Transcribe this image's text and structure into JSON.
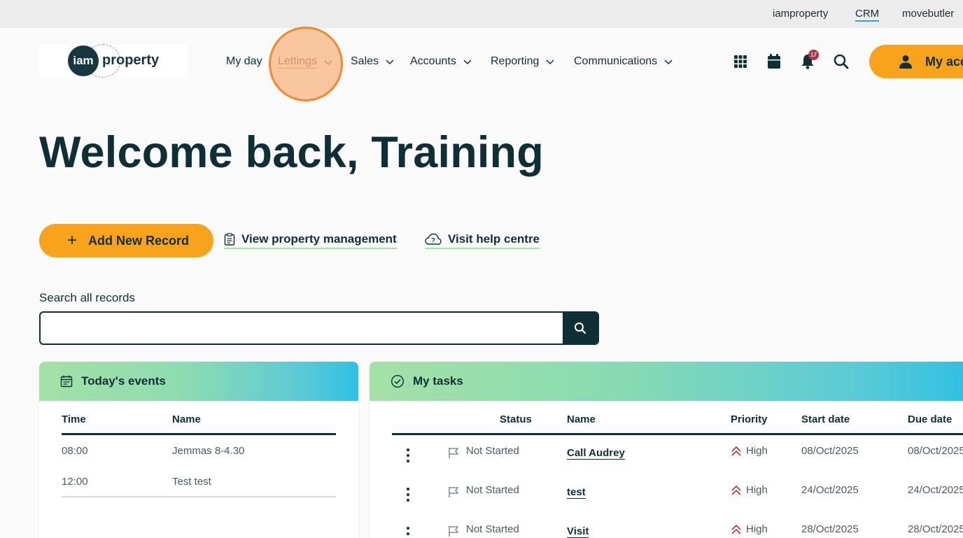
{
  "utility_bar": {
    "links": [
      "iamproperty",
      "CRM",
      "movebutler"
    ],
    "active": "CRM"
  },
  "logo": {
    "mark": "iam",
    "word": "property"
  },
  "nav": {
    "items": [
      "My day",
      "Lettings",
      "Sales",
      "Accounts",
      "Reporting",
      "Communications"
    ],
    "active": "Lettings"
  },
  "header_icons": [
    "apps-grid-icon",
    "calendar-icon",
    "bell-icon",
    "search-icon"
  ],
  "notifications": {
    "count": "17"
  },
  "account": {
    "label": "My account"
  },
  "welcome": {
    "title": "Welcome back, Training"
  },
  "actions": {
    "add_record": "Add New Record",
    "view_property_management": "View property management",
    "visit_help_centre": "Visit help centre"
  },
  "search": {
    "label": "Search all records",
    "value": "",
    "placeholder": ""
  },
  "events": {
    "title": "Today's events",
    "columns": [
      "Time",
      "Name"
    ],
    "rows": [
      {
        "time": "08:00",
        "name": "Jemmas 8-4.30"
      },
      {
        "time": "12:00",
        "name": "Test test"
      }
    ]
  },
  "tasks": {
    "title": "My tasks",
    "columns": [
      "Status",
      "Name",
      "Priority",
      "Start date",
      "Due date"
    ],
    "rows": [
      {
        "status": "Not Started",
        "name": "Call Audrey",
        "priority": "High",
        "start": "08/Oct/2025",
        "due": "08/Oct/2025"
      },
      {
        "status": "Not Started",
        "name": "test",
        "priority": "High",
        "start": "24/Oct/2025",
        "due": "24/Oct/2025"
      },
      {
        "status": "Not Started",
        "name": "Visit",
        "priority": "High",
        "start": "28/Oct/2025",
        "due": "28/Oct/2025"
      }
    ]
  },
  "colors": {
    "primary_dark": "#0f2f36",
    "accent_orange": "#f9a21b",
    "link_underline": "#a9e0a4",
    "badge_red": "#c22b3b",
    "priority_high": "#c22b3b"
  }
}
